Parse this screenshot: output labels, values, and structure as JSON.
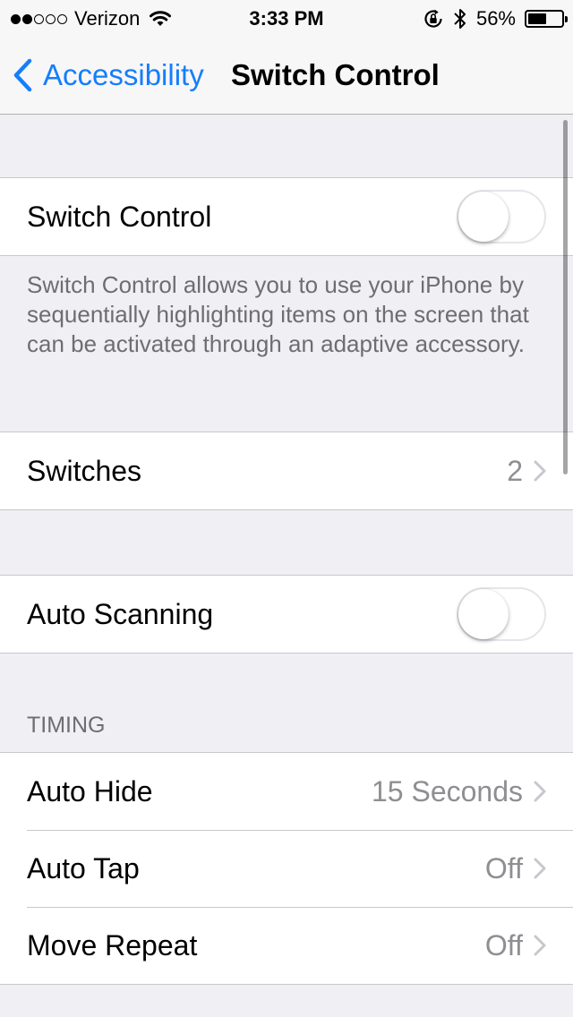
{
  "status_bar": {
    "carrier": "Verizon",
    "signal_bars_filled": 2,
    "signal_bars_total": 5,
    "time": "3:33 PM",
    "battery_percent": "56%",
    "battery_level": 0.56
  },
  "nav": {
    "back_label": "Accessibility",
    "title": "Switch Control"
  },
  "colors": {
    "accent": "#157efb",
    "background": "#efeff4",
    "secondary_text": "#8e8e93"
  },
  "switch_control": {
    "label": "Switch Control",
    "enabled": false,
    "description": "Switch Control allows you to use your iPhone by sequentially highlighting items on the screen that can be activated through an adaptive accessory."
  },
  "switches": {
    "label": "Switches",
    "value": "2"
  },
  "auto_scanning": {
    "label": "Auto Scanning",
    "enabled": false
  },
  "timing": {
    "header": "TIMING",
    "items": [
      {
        "label": "Auto Hide",
        "value": "15 Seconds"
      },
      {
        "label": "Auto Tap",
        "value": "Off"
      },
      {
        "label": "Move Repeat",
        "value": "Off"
      }
    ]
  }
}
